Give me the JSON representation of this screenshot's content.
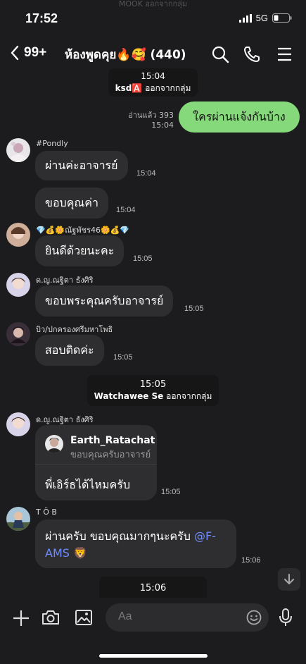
{
  "status": {
    "time": "17:52",
    "network": "5G",
    "ghost_text": "MOOK ออกจากกลุ่ม"
  },
  "header": {
    "back_count": "99+",
    "title": "ห้องพูดคุย🔥🥰 (440)"
  },
  "system": [
    {
      "time": "15:04",
      "name": "ksd🅰️",
      "text": "ออกจากกลุ่ม"
    },
    {
      "time": "15:05",
      "name": "Watchawee Se",
      "text": "ออกจากกลุ่ม"
    },
    {
      "time": "15:06"
    }
  ],
  "outgoing": {
    "read": "อ่านแล้ว 393",
    "time": "15:04",
    "text": "ใครผ่านแจ้งกันบ้าง"
  },
  "messages": [
    {
      "sender": "#Pondly",
      "bubbles": [
        {
          "text": "ผ่านค่ะอาจารย์",
          "time": "15:04"
        },
        {
          "text": "ขอบคุณค่า",
          "time": "15:04"
        }
      ]
    },
    {
      "sender": "💎💰🌼ณัฐพัชร46🌼💰💎",
      "bubbles": [
        {
          "text": "ยินดีด้วยนะคะ",
          "time": "15:05"
        }
      ]
    },
    {
      "sender": "ด.ญ.ณฐิตา ธังศิริ",
      "bubbles": [
        {
          "text": "ขอบพระคุณครับอาจารย์",
          "time": "15:05"
        }
      ]
    },
    {
      "sender": "บิว/ปกครองศรีมหาโพธิ",
      "bubbles": [
        {
          "text": "สอบติดค่ะ",
          "time": "15:05"
        }
      ]
    },
    {
      "sender": "ด.ญ.ณฐิตา ธังศิริ",
      "reply": {
        "name": "Earth_Ratachat",
        "text": "ขอบคุณครับอาจารย์"
      },
      "bubbles": [
        {
          "text": "พี่เอิร์ธได้ไหมครับ",
          "time": "15:05"
        }
      ]
    },
    {
      "sender": "T Ö B",
      "bubbles": [
        {
          "text": "ผ่านครับ ขอบคุณมากๆนะครับ ",
          "mention": "@F-AMS",
          "emoji": "🦁",
          "time": "15:06"
        }
      ]
    }
  ],
  "input": {
    "placeholder": "Aa"
  },
  "colors": {
    "background": "#1c1c1e",
    "bubble": "#2e2e30",
    "outgoing": "#86d97a",
    "mention": "#6f8cff"
  }
}
